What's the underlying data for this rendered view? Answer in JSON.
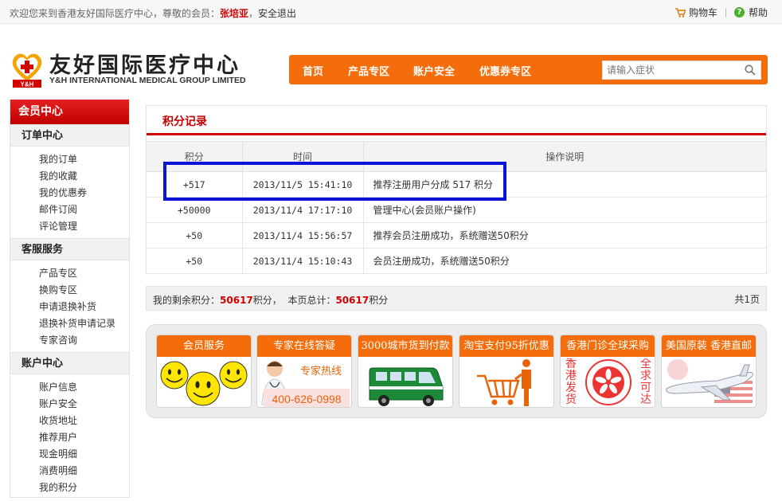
{
  "topbar": {
    "welcome_prefix": "欢迎您来到香港友好国际医疗中心，尊敬的会员：",
    "username": "张培亚",
    "logout": "安全退出",
    "cart": "购物车",
    "help": "帮助"
  },
  "logo": {
    "badge": "Y&H",
    "name_cn": "友好国际医疗中心",
    "name_en": "Y&H INTERNATIONAL MEDICAL GROUP LIMITED"
  },
  "nav": {
    "items": [
      "首页",
      "产品专区",
      "账户安全",
      "优惠券专区"
    ],
    "search_placeholder": "请输入症状"
  },
  "sidebar": {
    "title": "会员中心",
    "sections": [
      {
        "title": "订单中心",
        "items": [
          "我的订单",
          "我的收藏",
          "我的优惠券",
          "邮件订阅",
          "评论管理"
        ]
      },
      {
        "title": "客服服务",
        "items": [
          "产品专区",
          "换购专区",
          "申请退换补货",
          "退换补货申请记录",
          "专家咨询"
        ]
      },
      {
        "title": "账户中心",
        "items": [
          "账户信息",
          "账户安全",
          "收货地址",
          "推荐用户",
          "现金明细",
          "消费明细",
          "我的积分"
        ]
      }
    ]
  },
  "points": {
    "title": "积分记录",
    "headers": [
      "积分",
      "时间",
      "操作说明"
    ],
    "rows": [
      {
        "points": "+517",
        "time": "2013/11/5 15:41:10",
        "desc": "推荐注册用户分成 517 积分"
      },
      {
        "points": "+50000",
        "time": "2013/11/4 17:17:10",
        "desc": "管理中心(会员账户操作)"
      },
      {
        "points": "+50",
        "time": "2013/11/4 15:56:57",
        "desc": "推荐会员注册成功，系统赠送50积分"
      },
      {
        "points": "+50",
        "time": "2013/11/4 15:10:43",
        "desc": "会员注册成功，系统赠送50积分"
      }
    ]
  },
  "summary": {
    "remaining_label": "我的剩余积分：",
    "remaining_value": "50617",
    "unit": "积分",
    "sep": "，",
    "page_total_label": "本页总计：",
    "page_total_value": "50617",
    "unit2": "积分",
    "pages": "共1页"
  },
  "promo": {
    "cards": [
      {
        "title": "会员服务"
      },
      {
        "title": "专家在线答疑",
        "line1": "专家热线",
        "line2": "400-626-0998"
      },
      {
        "title": "3000城市货到付款"
      },
      {
        "title": "淘宝支付95折优惠"
      },
      {
        "title": "香港门诊全球采购",
        "left": "香港发货",
        "right": "全求可达"
      },
      {
        "title": "美国原装 香港直邮"
      }
    ]
  },
  "colors": {
    "accent_orange": "#f46d0a",
    "brand_red": "#d40000",
    "highlight_blue": "#0a14d8"
  }
}
